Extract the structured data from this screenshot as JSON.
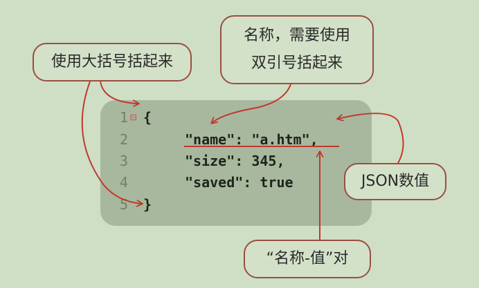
{
  "callouts": {
    "braces": "使用大括号括起来",
    "name_quotes_line1": "名称，需要使用",
    "name_quotes_line2": "双引号括起来",
    "json_value": "JSON数值",
    "name_value_pair": "“名称-值”对"
  },
  "code": {
    "lines": [
      {
        "number": "1",
        "text": "{"
      },
      {
        "number": "2",
        "text": "\"name\": \"a.htm\","
      },
      {
        "number": "3",
        "text": "\"size\": 345,"
      },
      {
        "number": "4",
        "text": "\"saved\": true"
      },
      {
        "number": "5",
        "text": "}"
      }
    ]
  },
  "colors": {
    "background": "#cfdfc5",
    "panel": "#a8b89f",
    "arrow": "#c0392b",
    "bubble_border": "#9a4e42"
  }
}
